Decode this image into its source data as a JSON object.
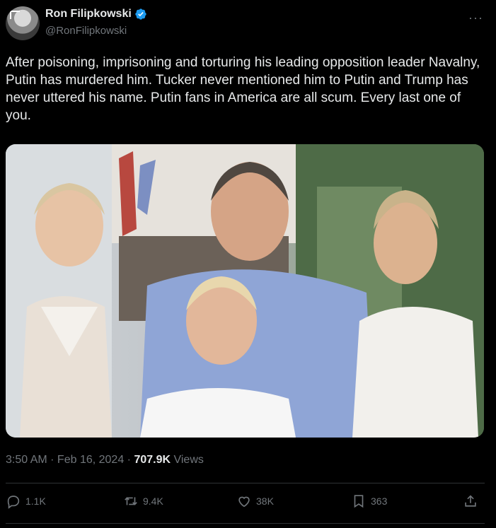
{
  "author": {
    "display_name": "Ron Filipkowski",
    "handle": "@RonFilipkowski",
    "verified": true
  },
  "tweet": {
    "text": "After poisoning, imprisoning and torturing his leading opposition leader Navalny, Putin has murdered him. Tucker never mentioned him to Putin and Trump has never uttered his name. Putin fans in America are all scum. Every last one of you."
  },
  "meta": {
    "time": "3:50 AM",
    "separator": " · ",
    "date": "Feb 16, 2024",
    "views_count": "707.9K",
    "views_label": "Views"
  },
  "actions": {
    "replies": "1.1K",
    "reposts": "9.4K",
    "likes": "38K",
    "bookmarks": "363"
  },
  "icons": {
    "more": "more-icon",
    "verified": "verified-badge-icon",
    "reply": "reply-icon",
    "repost": "repost-icon",
    "like": "heart-icon",
    "bookmark": "bookmark-icon",
    "share": "share-icon"
  },
  "colors": {
    "background": "#000000",
    "text": "#e7e9ea",
    "muted": "#71767b",
    "verified": "#1d9bf0"
  }
}
